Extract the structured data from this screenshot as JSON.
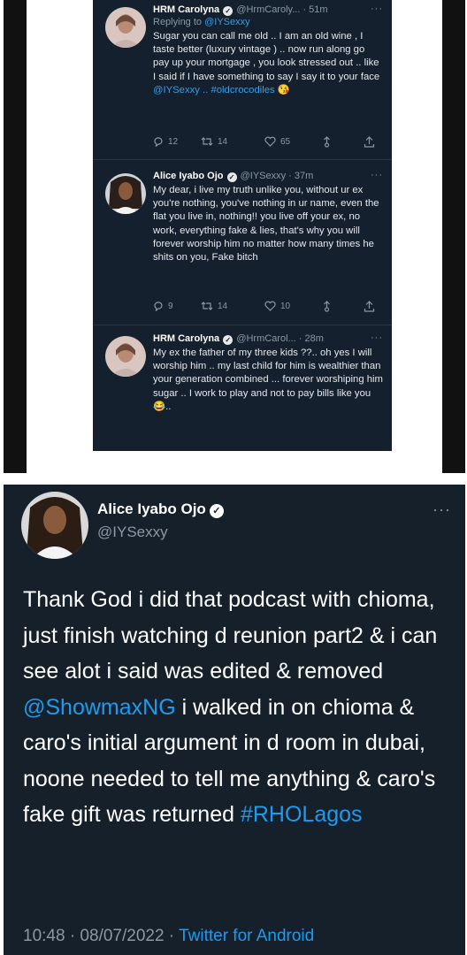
{
  "thread": {
    "tweets": [
      {
        "name": "HRM Carolyna",
        "verified": true,
        "handle": "@HrmCaroly...",
        "time": "· 51m",
        "more": "···",
        "reply_prefix": "Replying to ",
        "reply_handle": "@IYSexxy",
        "text": "Sugar you can call me old .. I am an old wine , I taste better (luxury vintage ) .. now run along go pay up your mortgage , you look stressed out .. like I said if I have something to say I say it to your face",
        "text_links": "@IYSexxy .. #oldcrocodiles",
        "text_emoji": "😘",
        "replies": "12",
        "retweets": "14",
        "likes": "65"
      },
      {
        "name": "Alice Iyabo Ojo",
        "verified": true,
        "handle": "@IYSexxy",
        "time": "· 37m",
        "more": "···",
        "text": "My dear, i live my truth unlike you, without ur ex you're nothing, you've nothing in ur name, even the flat you live in, nothing!! you live off your ex, no work, everything fake & lies, that's why you will forever worship him no matter how many times he shits on you, Fake bitch",
        "replies": "9",
        "retweets": "14",
        "likes": "10"
      },
      {
        "name": "HRM Carolyna",
        "verified": true,
        "handle": "@HrmCarol...",
        "time": "· 28m",
        "more": "···",
        "text": "My ex the father of my three kids ??.. oh yes I will worship him .. my last child for him is wealthier than your generation combined ... forever worshiping him sugar .. I work to play and not to pay bills like you",
        "text_emoji": "😂.."
      }
    ]
  },
  "main_tweet": {
    "name": "Alice Iyabo Ojo",
    "verified": true,
    "handle": "@IYSexxy",
    "more": "···",
    "text_part1": "Thank God i did that podcast with chioma, just finish watching d reunion part2 & i can see alot i said was edited & removed ",
    "mention": "@ShowmaxNG",
    "text_part2": " i walked in on chioma & caro's initial argument in d room in dubai, noone needed to tell me anything & caro's fake gift was returned ",
    "hashtag": "#RHOLagos",
    "time": "10:48 · 08/07/2022 · ",
    "client": "Twitter for Android"
  },
  "colors": {
    "thread_bg": "#14202e",
    "main_bg": "#15202b",
    "link": "#1d9bf0",
    "muted": "#8b98a5"
  },
  "icons": [
    "reply-icon",
    "retweet-icon",
    "like-icon",
    "share-icon",
    "upload-icon",
    "verified-badge-icon",
    "more-icon"
  ]
}
